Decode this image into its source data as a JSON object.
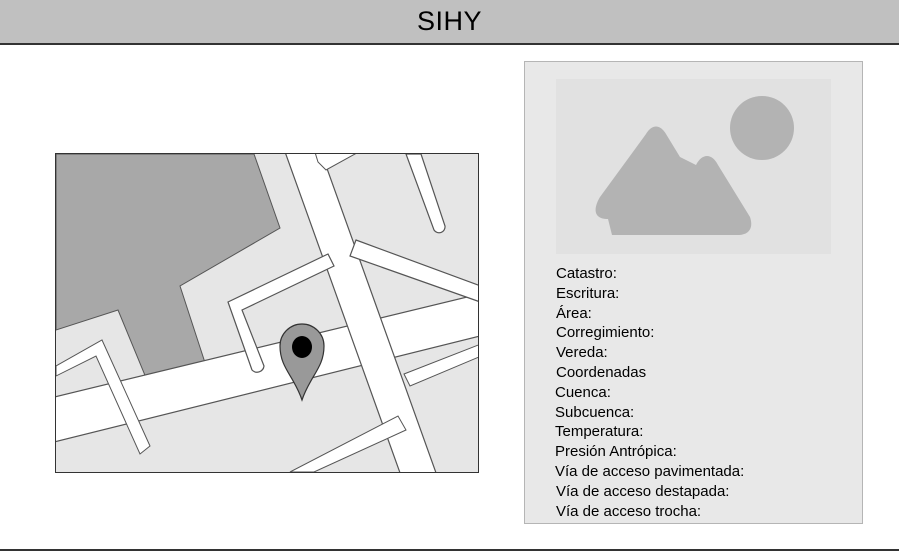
{
  "header": {
    "title": "SIHY"
  },
  "map": {
    "icon": "map-pin-icon",
    "pin_color": "#999999"
  },
  "photo": {
    "icon": "image-placeholder-icon"
  },
  "fields": [
    {
      "label": "Catastro:"
    },
    {
      "label": "Escritura:"
    },
    {
      "label": "Área:"
    },
    {
      "label": "Corregimiento:"
    },
    {
      "label": "Vereda:"
    },
    {
      "label": "Coordenadas"
    },
    {
      "label": "Cuenca:"
    },
    {
      "label": "Subcuenca:"
    },
    {
      "label": "Temperatura:"
    },
    {
      "label": "Presión Antrópica:"
    },
    {
      "label": "Vía de acceso pavimentada:"
    },
    {
      "label": "Vía de acceso destapada:"
    },
    {
      "label": "Vía de acceso trocha:"
    }
  ]
}
